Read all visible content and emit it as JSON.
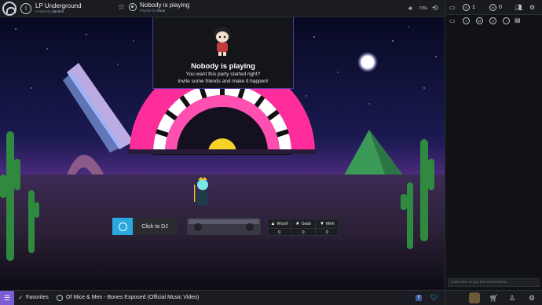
{
  "room": {
    "name": "LP Underground",
    "hosted_prefix": "Hosted by",
    "host": "jfan920"
  },
  "now_playing": {
    "title": "Nobody is playing",
    "playlist_prefix": "Playlist by",
    "playlist_owner": "None"
  },
  "volume": {
    "percent": "73%"
  },
  "stage": {
    "heading": "Nobody is playing",
    "line1": "You want this party started right?",
    "line2": "Invite some friends and make it happen!"
  },
  "dj_button": {
    "label": "Click to DJ"
  },
  "votes": {
    "woot_label": "Woot!",
    "grab_label": "Grab",
    "meh_label": "Meh",
    "woot_count": "0",
    "grab_count": "0",
    "meh_count": "0"
  },
  "bottombar": {
    "favorites": "Favorites",
    "track": "Of Mice & Men - Bones Exposed (Official Music Video)",
    "facebook": "f"
  },
  "right_panel": {
    "staff_count": "1",
    "waitlist_count": "0"
  },
  "chat": {
    "placeholder": "Click here to join the conversation"
  },
  "icons": [
    "plug-logo-icon",
    "room-info-icon",
    "star-icon",
    "now-playing-icon",
    "volume-icon",
    "history-icon",
    "chat-icon",
    "staff-icon",
    "waitlist-icon",
    "users-icon",
    "settings-icon",
    "menu-icon",
    "check-icon",
    "playlist-icon",
    "facebook-icon",
    "twitter-icon",
    "shop-icon",
    "gear-icon"
  ],
  "colors": {
    "accent": "#2aa9e0",
    "menu": "#7d5bd6",
    "panel_border": "#4a3aa4"
  }
}
